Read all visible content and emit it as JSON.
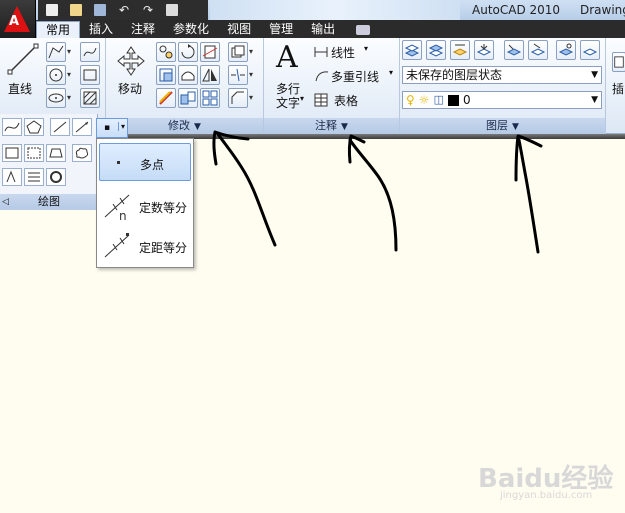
{
  "title": {
    "app_name": "AutoCAD 2010",
    "document": "Drawing"
  },
  "tabs": [
    {
      "label": "常用",
      "active": true
    },
    {
      "label": "插入",
      "active": false
    },
    {
      "label": "注释",
      "active": false
    },
    {
      "label": "参数化",
      "active": false
    },
    {
      "label": "视图",
      "active": false
    },
    {
      "label": "管理",
      "active": false
    },
    {
      "label": "输出",
      "active": false
    }
  ],
  "draw_panel": {
    "line_label": "直线",
    "title": "绘图"
  },
  "modify_panel": {
    "move_label": "移动",
    "title": "修改"
  },
  "annotate_panel": {
    "mtext_label_1": "多行",
    "mtext_label_2": "文字",
    "linear_label": "线性",
    "mleader_label": "多重引线",
    "table_label": "表格",
    "title": "注释"
  },
  "layers_panel": {
    "layer_state": "未保存的图层状态",
    "current_layer": "0",
    "title": "图层"
  },
  "right_partial": {
    "label": "插"
  },
  "point_menu": {
    "items": [
      {
        "label": "多点",
        "selected": true
      },
      {
        "label": "定数等分",
        "selected": false
      },
      {
        "label": "定距等分",
        "selected": false
      }
    ]
  },
  "watermark": {
    "brand": "Baidu经验",
    "url": "jingyan.baidu.com"
  },
  "colors": {
    "ribbon_bg": "#dde8f5",
    "tab_bar": "#2b2b2b",
    "canvas": "#fffdf0",
    "selected_item": "#c5dcf7"
  }
}
